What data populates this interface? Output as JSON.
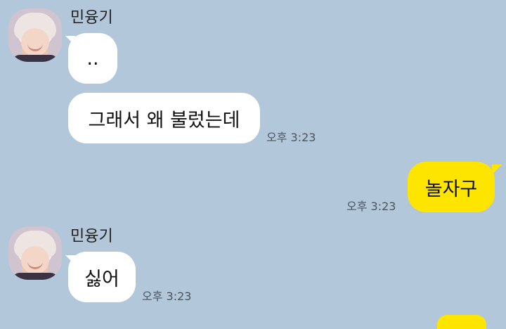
{
  "messages": [
    {
      "sender": "민융기",
      "text": "..",
      "time": ""
    },
    {
      "sender": "민융기",
      "text": "그래서 왜 불렀는데",
      "time": "오후 3:23"
    },
    {
      "sender": "me",
      "text": "놀자구",
      "time": "오후 3:23"
    },
    {
      "sender": "민융기",
      "text": "싫어",
      "time": "오후 3:23"
    }
  ],
  "colors": {
    "background": "#b2c7d9",
    "incoming_bubble": "#ffffff",
    "outgoing_bubble": "#fee500"
  },
  "icons": [
    "profile-avatar"
  ]
}
